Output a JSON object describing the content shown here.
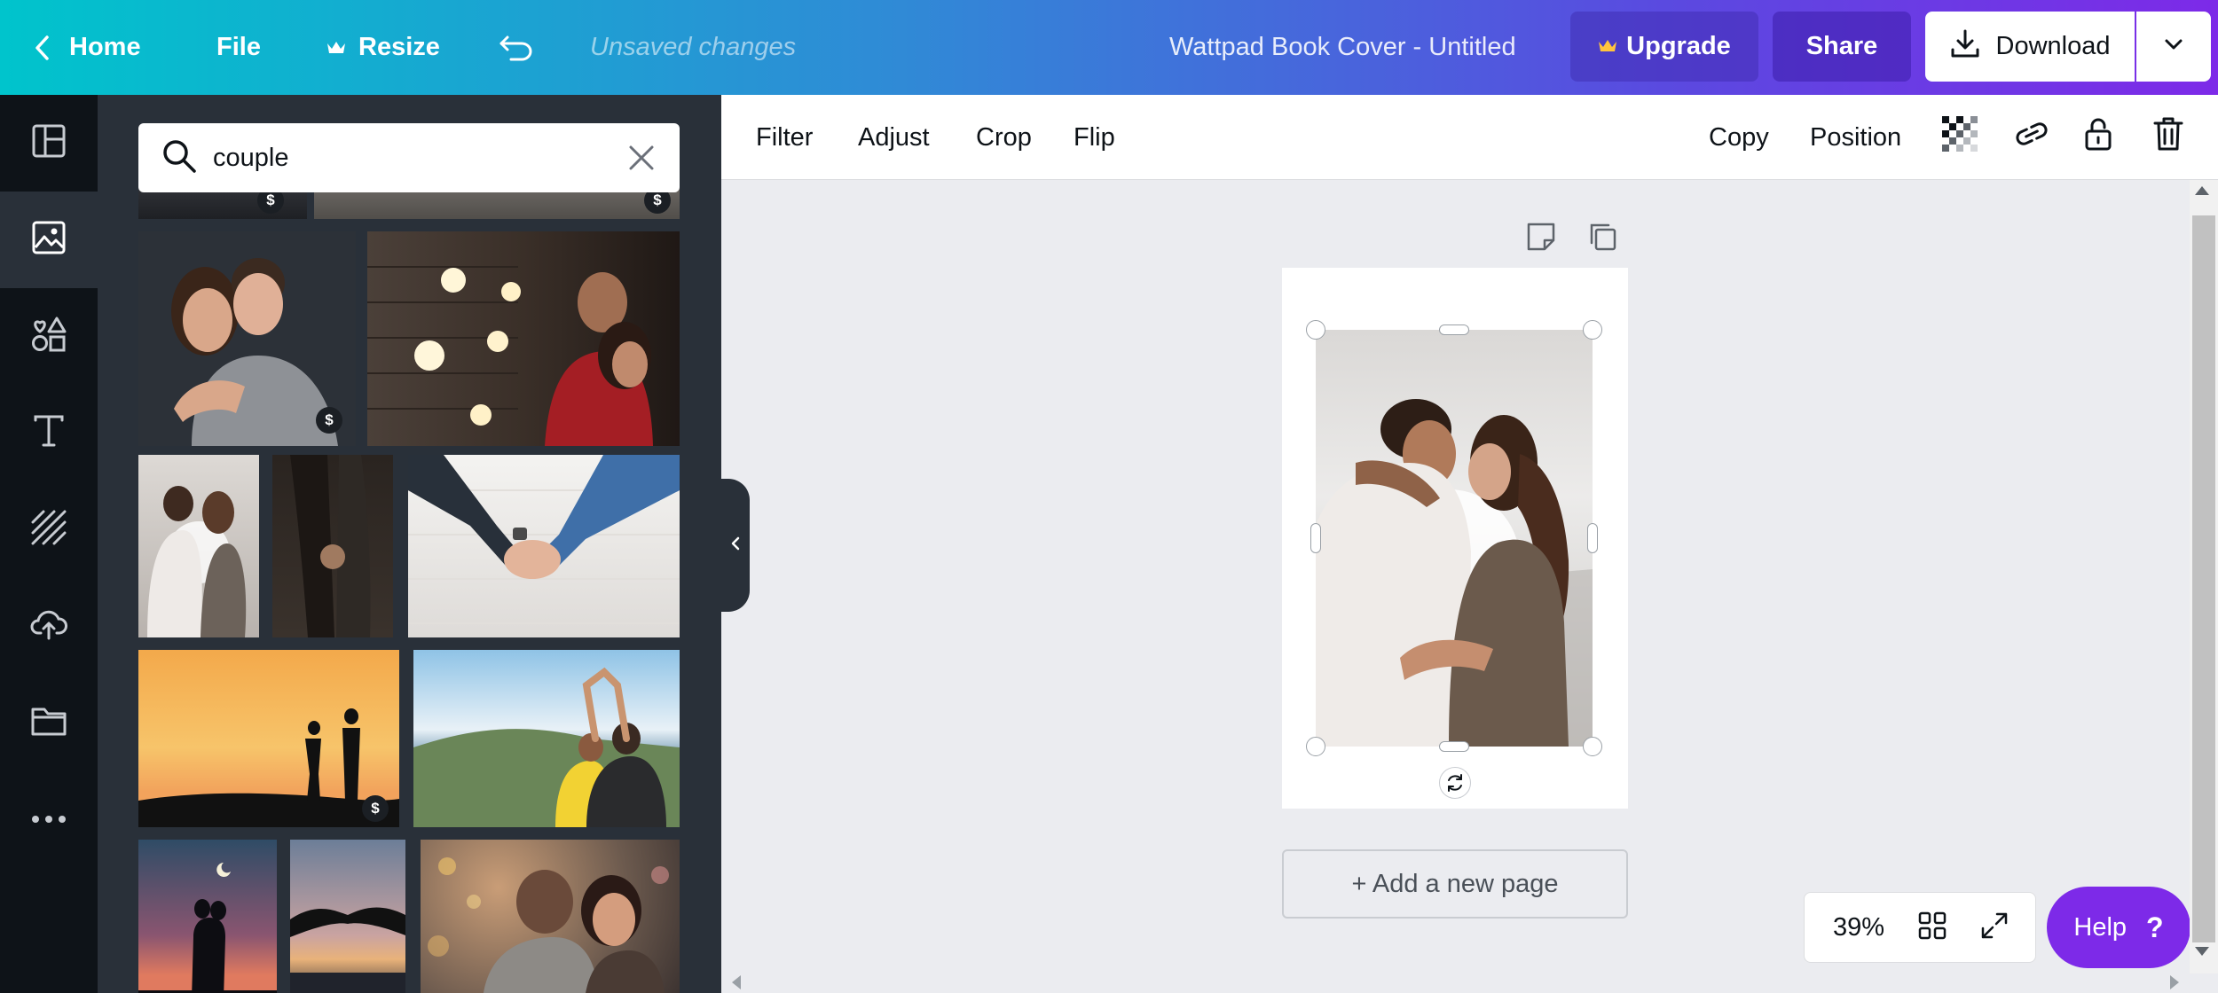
{
  "topbar": {
    "home_label": "Home",
    "file_label": "File",
    "resize_label": "Resize",
    "unsaved_label": "Unsaved changes",
    "doc_title": "Wattpad Book Cover - Untitled",
    "upgrade_label": "Upgrade",
    "share_label": "Share",
    "download_label": "Download"
  },
  "rail": {
    "items": [
      "templates",
      "photos",
      "elements",
      "text",
      "background",
      "uploads",
      "folders",
      "more"
    ],
    "active": "photos"
  },
  "search": {
    "query": "couple"
  },
  "photos": {
    "premium_badge": "$",
    "items": [
      {
        "name": "couple-smiling-hug",
        "premium": true
      },
      {
        "name": "couple-bulbs-night",
        "premium": false
      },
      {
        "name": "couple-sunlit-kiss",
        "premium": false
      },
      {
        "name": "couple-dark-hands",
        "premium": false
      },
      {
        "name": "hands-holding-brick",
        "premium": false
      },
      {
        "name": "silhouette-sunset",
        "premium": true
      },
      {
        "name": "couple-heart-hands-lake",
        "premium": false
      },
      {
        "name": "silhouette-moon-kiss",
        "premium": false
      },
      {
        "name": "silhouette-beach-hands",
        "premium": false
      },
      {
        "name": "couple-bokeh-laugh",
        "premium": false
      }
    ]
  },
  "context_toolbar": {
    "filter_label": "Filter",
    "adjust_label": "Adjust",
    "crop_label": "Crop",
    "flip_label": "Flip",
    "copy_label": "Copy",
    "position_label": "Position"
  },
  "canvas": {
    "add_page_label": "+ Add a new page"
  },
  "zoom": {
    "value": "39%"
  },
  "help": {
    "label": "Help",
    "symbol": "?"
  },
  "colors": {
    "brand_purple": "#7d2ae8",
    "brand_teal": "#00c4cc",
    "rail_bg": "#0e1318",
    "panel_bg": "#293039",
    "canvas_bg": "#ebecf0"
  }
}
